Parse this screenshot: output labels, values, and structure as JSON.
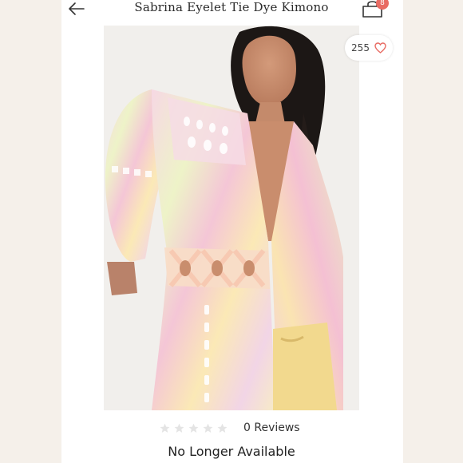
{
  "header": {
    "title": "Sabrina Eyelet Tie Dye Kimono",
    "cart_count": "8"
  },
  "product": {
    "likes": "255",
    "reviews_label": "0 Reviews",
    "rating_stars": 0,
    "availability": "No Longer Available"
  },
  "colors": {
    "badge": "#e86b63",
    "heart": "#e86b63",
    "star_empty": "#e4e4e4"
  }
}
